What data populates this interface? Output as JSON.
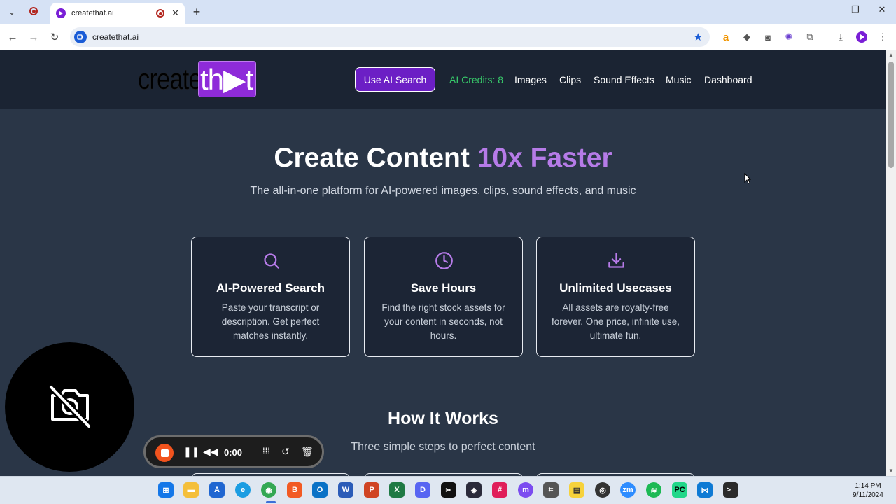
{
  "browser": {
    "tab_title": "createthat.ai",
    "url": "createthat.ai"
  },
  "header": {
    "logo_text_a": "create",
    "logo_text_b": "th▶t",
    "ai_search_button": "Use AI Search",
    "credits": "AI Credits: 8",
    "nav": [
      "Images",
      "Clips",
      "Sound Effects",
      "Music",
      "Dashboard"
    ]
  },
  "hero": {
    "title_main": "Create Content ",
    "title_accent": "10x Faster",
    "subtitle": "The all-in-one platform for AI-powered images, clips, sound effects, and music"
  },
  "features": [
    {
      "icon": "search-icon",
      "title": "AI-Powered Search",
      "desc": "Paste your transcript or description. Get perfect matches instantly."
    },
    {
      "icon": "clock-icon",
      "title": "Save Hours",
      "desc": "Find the right stock assets for your content in seconds, not hours."
    },
    {
      "icon": "download-icon",
      "title": "Unlimited Usecases",
      "desc": "All assets are royalty-free forever. One price, infinite use, ultimate fun."
    }
  ],
  "how_it_works": {
    "title": "How It Works",
    "subtitle": "Three simple steps to perfect content"
  },
  "recorder": {
    "time": "0:00"
  },
  "clock": {
    "time": "1:14 PM",
    "date": "9/11/2024"
  },
  "colors": {
    "accent": "#b67be8",
    "brand_purple": "#6c1fc5",
    "credits_green": "#37c96a",
    "page_bg": "#2a3647",
    "header_bg": "#1b2433"
  }
}
